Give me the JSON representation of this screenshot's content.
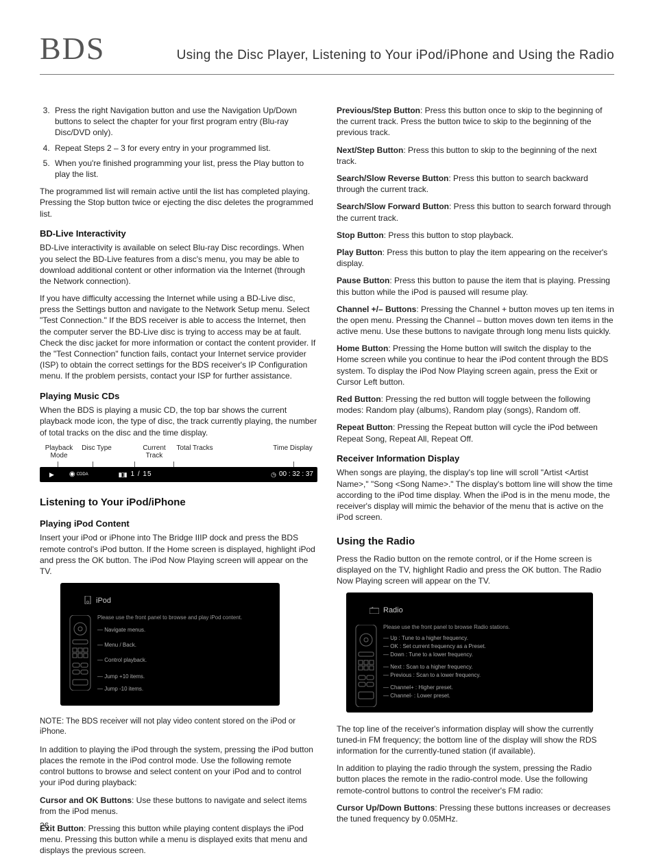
{
  "header": {
    "logo": "BDS",
    "title": "Using the Disc Player, Listening to Your iPod/iPhone and Using the Radio"
  },
  "left": {
    "step3": "Press the right Navigation button and use the Navigation Up/Down buttons to select the chapter for your first program entry (Blu-ray Disc/DVD only).",
    "step4": "Repeat Steps 2 – 3 for every entry in your programmed list.",
    "step5": "When you're finished programming your list, press the Play button to play the list.",
    "prog_para": "The programmed list will remain active until the list has completed playing. Pressing the Stop button twice or ejecting the disc deletes the programmed list.",
    "bdlive_h": "BD-Live Interactivity",
    "bdlive_p1": "BD-Live interactivity is available on select Blu-ray Disc recordings. When you select the BD-Live features from a disc's menu, you may be able to download additional content or other information via the Internet (through the Network connection).",
    "bdlive_p2": "If you have difficulty accessing the Internet while using a BD-Live disc, press the Settings button and navigate to the Network Setup menu. Select \"Test Connection.\" If the BDS receiver is able to access the Internet, then the computer server the BD-Live disc is trying to access may be at fault. Check the disc jacket for more information or contact the content provider. If the \"Test Connection\" function fails, contact your Internet service provider (ISP) to obtain the correct settings for the BDS receiver's IP Configuration menu. If the problem persists, contact your ISP for further assistance.",
    "cds_h": "Playing Music CDs",
    "cds_p": "When the BDS is playing a music CD, the top bar shows the current playback mode icon, the type of disc, the track currently playing, the number of total tracks on the disc and the time display.",
    "diag": {
      "l_pb": "Playback Mode",
      "l_dt": "Disc Type",
      "l_ct": "Current Track",
      "l_tt": "Total Tracks",
      "l_td": "Time Display",
      "tracks": "1  /  15",
      "time": "00 : 32 : 37",
      "cdda": "CDDA"
    },
    "listen_h": "Listening to Your iPod/iPhone",
    "playipod_h": "Playing iPod Content",
    "playipod_p": "Insert your iPod or iPhone into The Bridge IIIP dock and press the BDS remote control's iPod button. If the Home screen is displayed, highlight iPod and press the OK button. The iPod Now Playing screen will appear on the TV.",
    "ipod_shot": {
      "title": "iPod",
      "hint": "Please use the front panel to browse and play iPod content.",
      "l1": "Navigate menus.",
      "l2": "Menu / Back.",
      "l3": "Control playback.",
      "l4": "Jump +10 items.",
      "l5": "Jump -10 items."
    },
    "note": "NOTE: The BDS receiver will not play video content stored on the iPod or iPhone.",
    "ipod_ctrl_p": "In addition to playing the iPod through the system, pressing the iPod button places the remote in the iPod control mode. Use the following remote control buttons to browse and select content on your iPod and to control your iPod during playback:",
    "btn_cursor_ok_b": "Cursor and OK Buttons",
    "btn_cursor_ok_t": ": Use these buttons to navigate and select items from the iPod menus.",
    "btn_exit_b": "Exit Button",
    "btn_exit_t": ": Pressing this button while playing content displays the iPod menu. Pressing this button while a menu is displayed exits that menu and displays the previous screen."
  },
  "right": {
    "btn_prev_b": "Previous/Step Button",
    "btn_prev_t": ": Press this button once to skip to the beginning of the current track. Press the button twice to skip to the beginning of the previous track.",
    "btn_next_b": "Next/Step Button",
    "btn_next_t": ": Press this button to skip to the beginning of the next track.",
    "btn_srev_b": "Search/Slow Reverse Button",
    "btn_srev_t": ": Press this button to search backward through the current track.",
    "btn_sfwd_b": "Search/Slow Forward Button",
    "btn_sfwd_t": ": Press this button to search forward through the current track.",
    "btn_stop_b": "Stop Button",
    "btn_stop_t": ": Press this button to stop playback.",
    "btn_play_b": "Play Button",
    "btn_play_t": ": Press this button to play the item appearing on the receiver's display.",
    "btn_pause_b": "Pause Button",
    "btn_pause_t": ": Press this button to pause the item that is playing. Pressing this button while the iPod is paused will resume play.",
    "btn_ch_b": "Channel +/– Buttons",
    "btn_ch_t": ": Pressing the Channel + button moves up ten items in the open menu. Pressing the Channel – button moves down ten items in the active menu. Use these buttons to navigate through long menu lists quickly.",
    "btn_home_b": "Home Button",
    "btn_home_t": ": Pressing the Home button will switch the display to the Home screen while you continue to hear the iPod content through the BDS system. To display the iPod Now Playing screen again, press the Exit or Cursor Left button.",
    "btn_red_b": "Red Button",
    "btn_red_t": ": Pressing the red button will toggle between the following modes: Random play (albums), Random play (songs), Random off.",
    "btn_rep_b": "Repeat Button",
    "btn_rep_t": ": Pressing the Repeat button will cycle the iPod between Repeat Song, Repeat All, Repeat Off.",
    "rid_h": "Receiver Information Display",
    "rid_p": "When songs are playing, the display's top line will scroll \"Artist <Artist Name>,\" \"Song <Song Name>.\" The display's bottom line will show the time according to the iPod time display. When the iPod is in the menu mode, the receiver's display will mimic the behavior of the menu that is active on the iPod screen.",
    "radio_h": "Using the Radio",
    "radio_p1": "Press the Radio button on the remote control, or if the Home screen is displayed on the TV, highlight Radio and press the OK button. The Radio Now Playing screen will appear on the TV.",
    "radio_shot": {
      "title": "Radio",
      "hint": "Please use the front panel to browse Radio stations.",
      "l1": "Up : Tune to a higher frequency.",
      "l2": "OK : Set current frequency as a Preset.",
      "l3": "Down : Tune to a lower frequency.",
      "l4": "Next : Scan to a higher frequency.",
      "l5": "Previous : Scan to a lower frequency.",
      "l6": "Channel+ : Higher preset.",
      "l7": "Channel- : Lower preset."
    },
    "radio_p2": "The top line of the receiver's information display will show the currently tuned-in FM frequency; the bottom line of the display will show the RDS information for the currently-tuned station (if available).",
    "radio_p3": "In addition to playing the radio through the system, pressing the Radio button places the remote in the radio-control mode. Use the following remote-control buttons to control the receiver's FM radio:",
    "btn_cud_b": "Cursor Up/Down Buttons",
    "btn_cud_t": ": Pressing these buttons increases or decreases the tuned frequency by 0.05MHz."
  },
  "page": "26"
}
